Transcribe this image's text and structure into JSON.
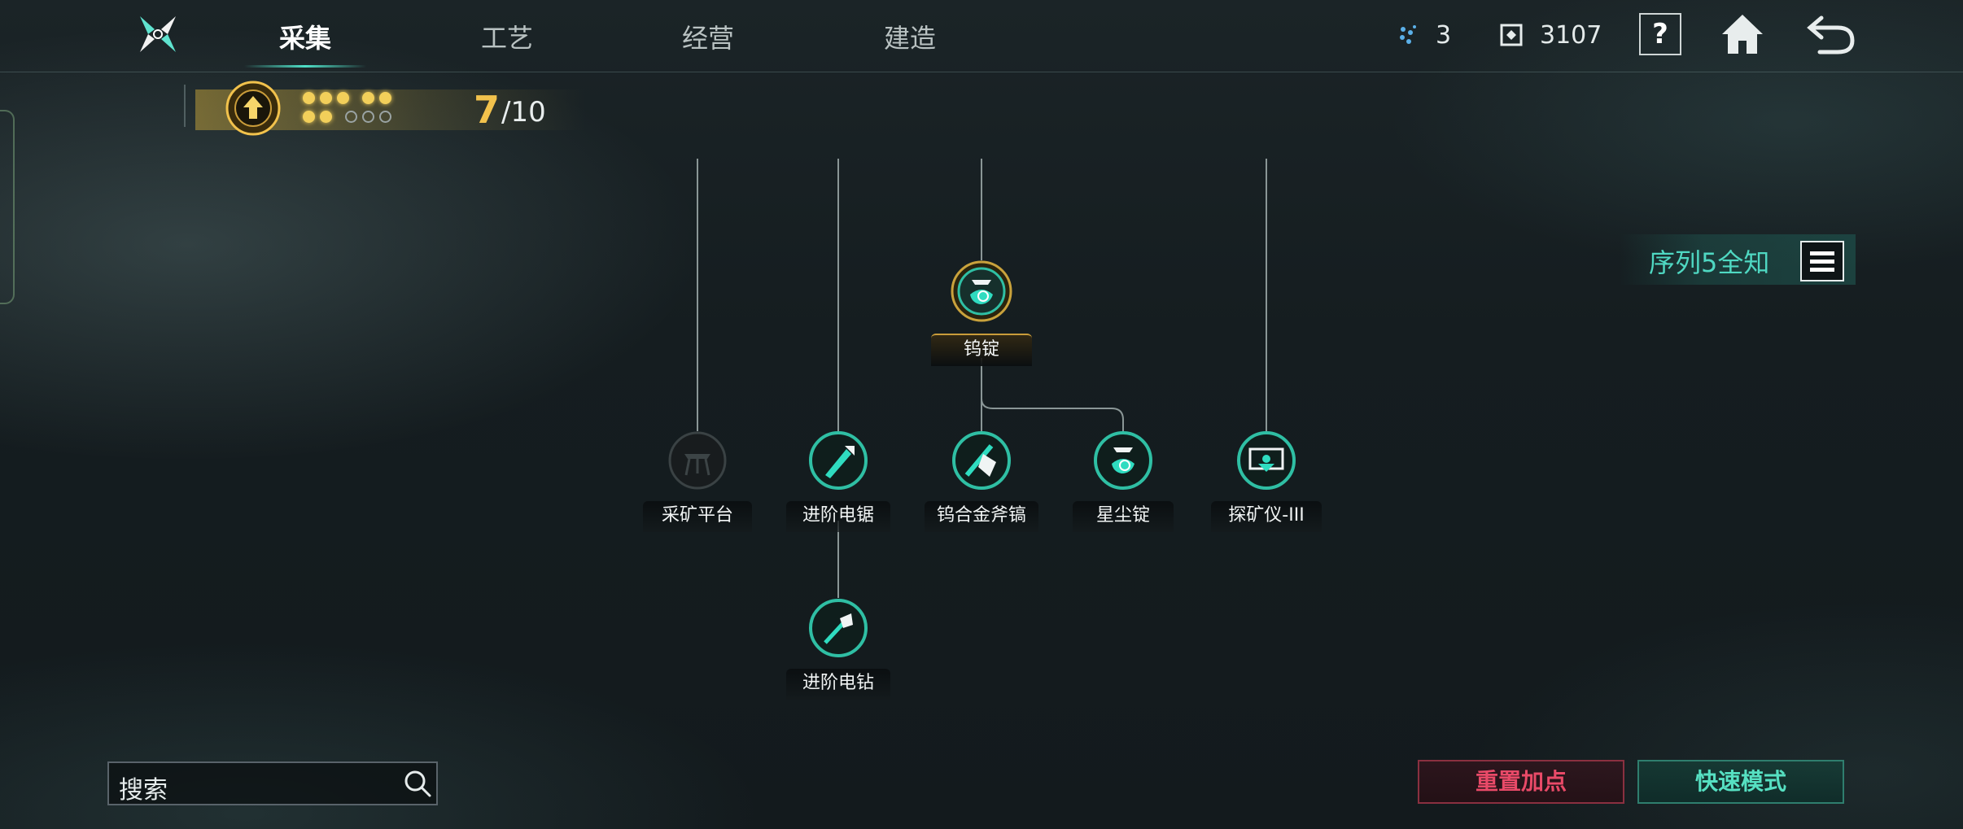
{
  "tabs": [
    "采集",
    "工艺",
    "经营",
    "建造"
  ],
  "resources": {
    "points": "3",
    "currency": "3107"
  },
  "help_label": "?",
  "progress": {
    "current": "7",
    "max": "/10",
    "filled_dots": 7,
    "total_dots": 10
  },
  "sequence_label": "序列5全知",
  "nodes": {
    "wu_ingot": "钨锭",
    "mining_platform": "采矿平台",
    "advanced_saw": "进阶电锯",
    "tungsten_axe_pick": "钨合金斧镐",
    "stardust_ingot": "星尘锭",
    "detector": "探矿仪-III",
    "advanced_drill": "进阶电钻"
  },
  "search": {
    "text": "搜索"
  },
  "buttons": {
    "reset": "重置加点",
    "fast_mode": "快速模式"
  },
  "colors": {
    "accent": "#4fd8c2",
    "gold": "#f2c24c",
    "reset": "#e94a68",
    "node_ring": "#2fbfa4"
  }
}
